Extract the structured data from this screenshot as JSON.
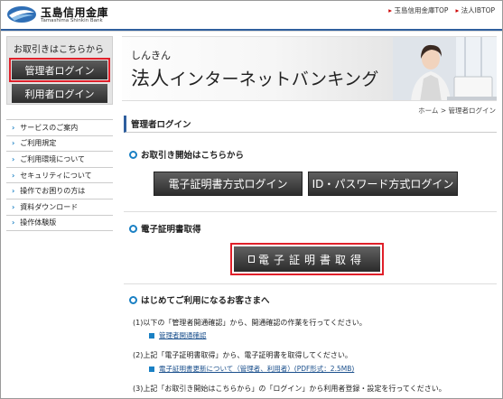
{
  "header": {
    "bank_name_jp": "玉島信用金庫",
    "bank_name_en": "Tamashima Shinkin Bank",
    "links": [
      {
        "label": "玉島信用金庫TOP"
      },
      {
        "label": "法人IBTOP"
      }
    ],
    "accent_color": "#2f5f9e"
  },
  "sidebar": {
    "title": "お取引きはこちらから",
    "admin_login_label": "管理者ログイン",
    "user_login_label": "利用者ログイン",
    "menu": [
      {
        "label": "サービスのご案内"
      },
      {
        "label": "ご利用規定"
      },
      {
        "label": "ご利用環境について"
      },
      {
        "label": "セキュリティについて"
      },
      {
        "label": "操作でお困りの方は"
      },
      {
        "label": "資料ダウンロード"
      },
      {
        "label": "操作体験版"
      }
    ]
  },
  "banner": {
    "subtitle": "しんきん",
    "title_kanji": "法人",
    "title_rest": "インターネットバンキング"
  },
  "breadcrumb": {
    "home": "ホーム",
    "sep": ">",
    "current": "管理者ログイン"
  },
  "main": {
    "page_title": "管理者ログイン",
    "section_start": "お取引き開始はこちらから",
    "cert_login_label": "電子証明書方式ログイン",
    "id_login_label": "ID・パスワード方式ログイン",
    "section_cert": "電子証明書取得",
    "cert_acquire_label": "電子証明書取得",
    "section_first": "はじめてご利用になるお客さまへ",
    "steps": [
      {
        "text": "(1)以下の「管理者開通確認」から、開通確認の作業を行ってください。",
        "link": "管理者開通確認"
      },
      {
        "text": "(2)上記「電子証明書取得」から、電子証明書を取得してください。",
        "link": "電子証明書更新について（管理者、利用者）(PDF形式：2.5MB)"
      },
      {
        "text": "(3)上記「お取引き開始はこちらから」の「ログイン」から利用者登録・設定を行ってください。",
        "link": ""
      }
    ]
  },
  "highlight_color": "#e0202a"
}
